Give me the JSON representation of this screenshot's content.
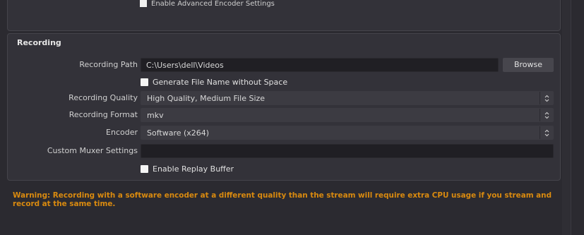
{
  "top_panel": {
    "checkbox_label": "Enable Advanced Encoder Settings"
  },
  "recording": {
    "title": "Recording",
    "path": {
      "label": "Recording Path",
      "value": "C:\\Users\\dell\\Videos",
      "browse_label": "Browse"
    },
    "generate_filename": {
      "label": "Generate File Name without Space",
      "checked": false
    },
    "quality": {
      "label": "Recording Quality",
      "value": "High Quality, Medium File Size"
    },
    "format": {
      "label": "Recording Format",
      "value": "mkv"
    },
    "encoder": {
      "label": "Encoder",
      "value": "Software (x264)"
    },
    "muxer": {
      "label": "Custom Muxer Settings",
      "value": ""
    },
    "replay_buffer": {
      "label": "Enable Replay Buffer",
      "checked": false
    }
  },
  "warning": "Warning: Recording with a software encoder at a different quality than the stream will require extra CPU usage if you stream and record at the same time.",
  "colors": {
    "background": "#2b2a30",
    "panel": "#333239",
    "input": "#201f24",
    "warning": "#d98a0f"
  }
}
